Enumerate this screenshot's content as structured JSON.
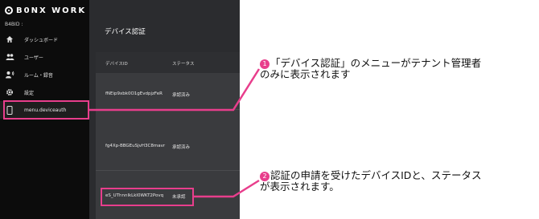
{
  "app": {
    "logo_text": "B0NX WORK",
    "tenant_label": "B4BID :"
  },
  "sidebar": {
    "items": [
      {
        "label": "ダッシュボード",
        "icon": "home-icon"
      },
      {
        "label": "ユーザー",
        "icon": "users-icon"
      },
      {
        "label": "ルーム・録音",
        "icon": "room-voice-icon"
      },
      {
        "label": "設定",
        "icon": "gear-icon"
      },
      {
        "label": "menu.deviceauth",
        "icon": "device-icon"
      }
    ]
  },
  "main": {
    "title": "デバイス認証",
    "table": {
      "headers": {
        "id": "デバイスID",
        "status": "ステータス"
      },
      "rows": [
        {
          "id": "fNEip9xbk0O1gEvdpjzFeR",
          "status": "承認済み"
        },
        {
          "id": "fg4Xp-BBGEuSjvH3C8mavr",
          "status": "承認済み"
        },
        {
          "id": "eS_UThnnlkLkl0WKT2Povq",
          "status": "未承認"
        }
      ]
    }
  },
  "callouts": [
    {
      "number": "❶",
      "text_line1": "「デバイス認証」のメニューがテナント管理者",
      "text_line2": "のみに表示されます"
    },
    {
      "number": "❷",
      "text_line1": "認証の申請を受けたデバイスIDと、ステータス",
      "text_line2": "が表示されます。"
    }
  ],
  "colors": {
    "accent": "#e83e8c",
    "sidebar_bg": "#0c0c0c",
    "main_bg": "#2b2c2f"
  }
}
